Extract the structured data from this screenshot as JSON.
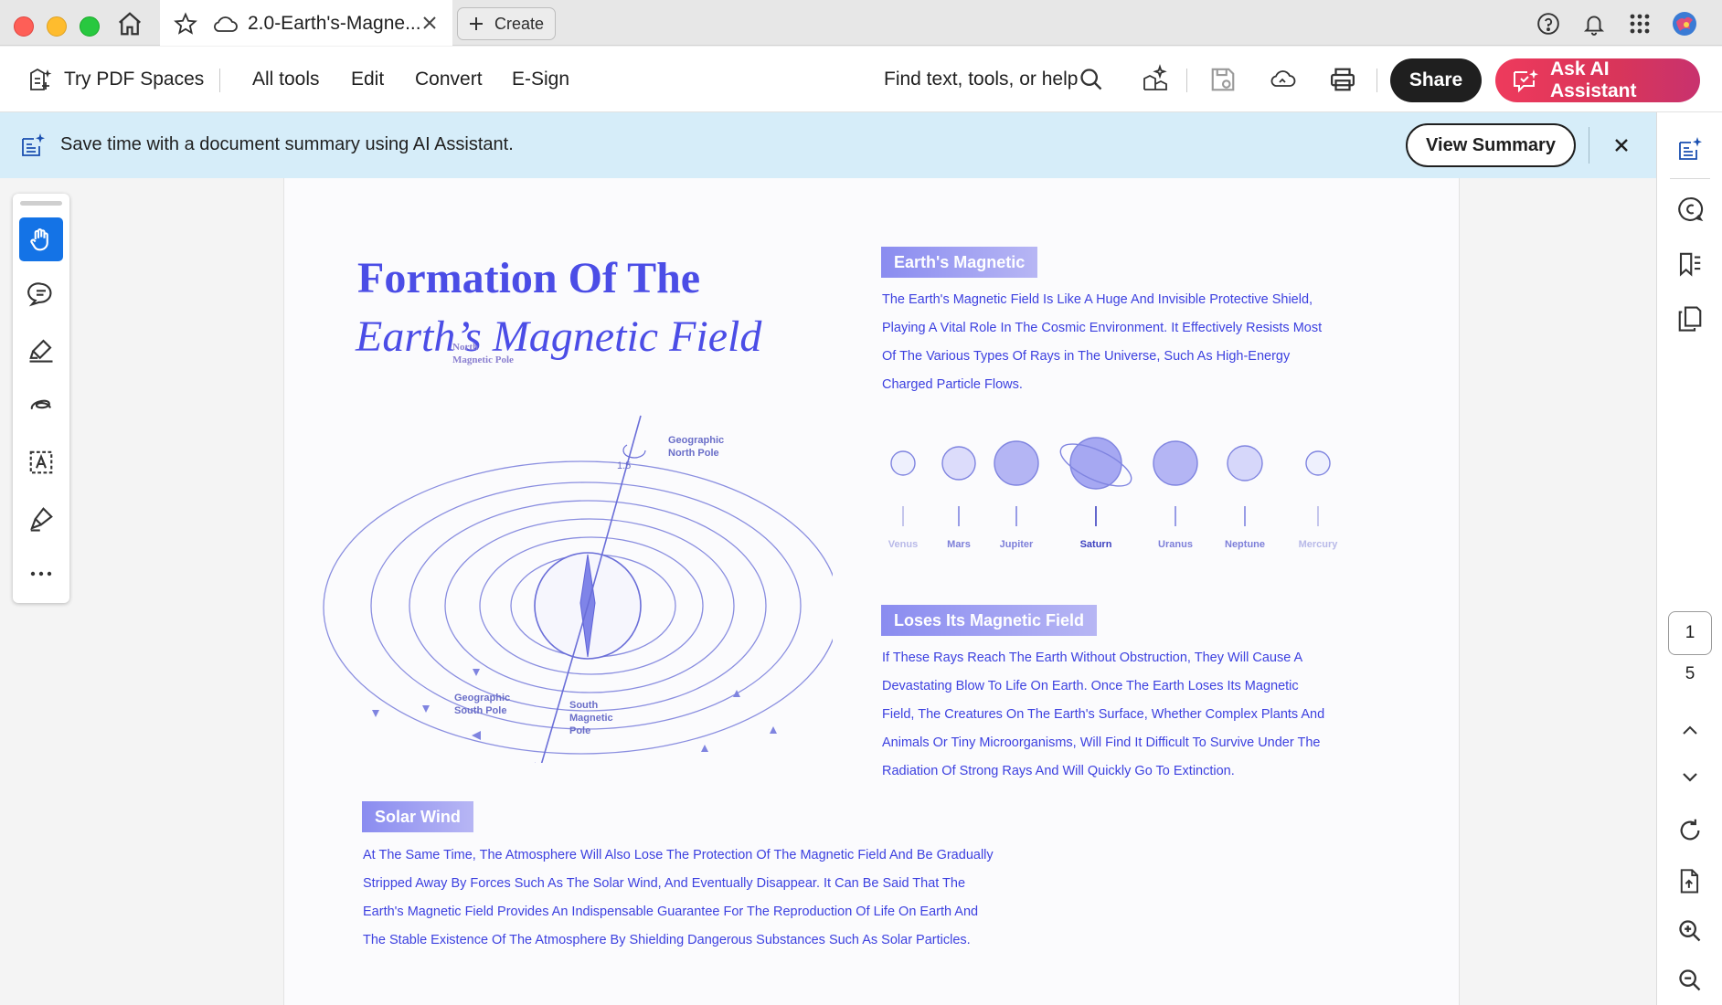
{
  "tab": {
    "title": "2.0-Earth's-Magne...",
    "create_label": "Create"
  },
  "toolbar": {
    "spaces": "Try PDF Spaces",
    "all_tools": "All tools",
    "edit": "Edit",
    "convert": "Convert",
    "esign": "E-Sign",
    "find": "Find text, tools, or help",
    "share": "Share",
    "ai_assistant": "Ask AI Assistant"
  },
  "banner": {
    "message": "Save time with a document summary using AI Assistant.",
    "view_summary": "View Summary"
  },
  "pager": {
    "current": "1",
    "total": "5"
  },
  "document": {
    "title_line1": "Formation Of The",
    "title_line2": "Earth’s Magnetic Field",
    "diagram": {
      "north_magnetic_pole": [
        "North",
        "Magnetic Pole"
      ],
      "geographic_north_pole": [
        "Geographic",
        "North Pole"
      ],
      "angle": "1.5",
      "geographic_south_pole": [
        "Geographic",
        "South Pole"
      ],
      "south_magnetic_pole": [
        "South",
        "Magnetic",
        "Pole"
      ]
    },
    "section_earth": {
      "label": "Earth's Magnetic",
      "lines": [
        "The Earth's Magnetic Field Is Like A Huge And Invisible Protective Shield,",
        "Playing A Vital Role In The Cosmic Environment. It Effectively Resists Most",
        "Of The Various Types Of Rays in The Universe, Such As High-Energy",
        "Charged Particle Flows."
      ]
    },
    "planets": [
      "Venus",
      "Mars",
      "Jupiter",
      "Saturn",
      "Uranus",
      "Neptune",
      "Mercury"
    ],
    "section_loses": {
      "label": "Loses Its Magnetic Field",
      "lines": [
        "If These Rays Reach The Earth Without Obstruction, They Will Cause A",
        "Devastating Blow To Life On Earth. Once The Earth Loses Its Magnetic",
        "Field, The Creatures On The Earth's Surface, Whether Complex Plants And",
        "Animals Or Tiny Microorganisms, Will Find It Difficult To Survive Under The",
        "Radiation Of Strong Rays And Will Quickly Go To Extinction."
      ]
    },
    "section_solar": {
      "label": "Solar Wind",
      "lines": [
        "At The Same Time, The Atmosphere Will Also Lose The Protection Of The Magnetic Field And Be Gradually",
        "Stripped Away By Forces Such As The Solar Wind, And Eventually Disappear. It Can Be Said That The",
        "Earth's Magnetic Field Provides An Indispensable Guarantee For The Reproduction Of Life On Earth And",
        "The Stable Existence Of The Atmosphere By Shielding Dangerous Substances Such As Solar Particles."
      ]
    }
  }
}
